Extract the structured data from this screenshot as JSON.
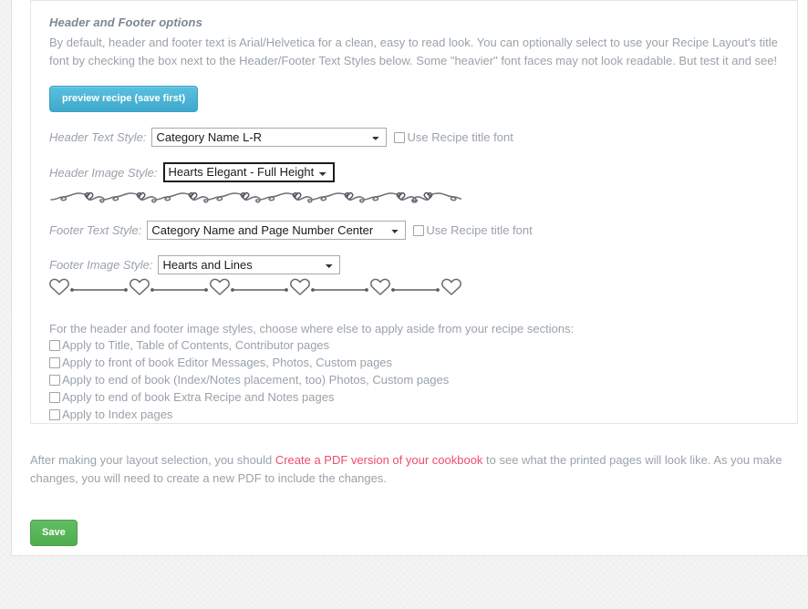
{
  "panel": {
    "title": "Header and Footer options",
    "description": "By default, header and footer text is Arial/Helvetica for a clean, easy to read look. You can optionally select to use your Recipe Layout's title font by checking the box next to the Header/Footer Text Styles below. Some \"heavier\" font faces may not look readable. But test it and see!",
    "preview_button": "preview recipe (save first)"
  },
  "fields": {
    "header_text": {
      "label": "Header Text Style:",
      "value": "Category Name L-R",
      "checkbox_label": "Use Recipe title font",
      "checked": false
    },
    "header_image": {
      "label": "Header Image Style:",
      "value": "Hearts Elegant - Full Height",
      "divider_name": "hearts-elegant-scrollwork-divider"
    },
    "footer_text": {
      "label": "Footer Text Style:",
      "value": "Category Name and Page Number Center",
      "checkbox_label": "Use Recipe title font",
      "checked": false
    },
    "footer_image": {
      "label": "Footer Image Style:",
      "value": "Hearts and Lines",
      "divider_name": "hearts-and-lines-divider"
    }
  },
  "apply_section": {
    "intro": "For the header and footer image styles, choose where else to apply aside from your recipe sections:",
    "options": [
      {
        "label": "Apply to Title, Table of Contents, Contributor pages",
        "checked": false
      },
      {
        "label": "Apply to front of book Editor Messages, Photos, Custom pages",
        "checked": false
      },
      {
        "label": "Apply to end of book (Index/Notes placement, too) Photos, Custom pages",
        "checked": false
      },
      {
        "label": "Apply to end of book Extra Recipe and Notes pages",
        "checked": false
      },
      {
        "label": "Apply to Index pages",
        "checked": false
      }
    ]
  },
  "footer": {
    "note_before": "After making your layout selection, you should ",
    "link_text": "Create a PDF version of your cookbook",
    "note_after": " to see what the printed pages will look like. As you make changes, you will need to create a new PDF to include the changes.",
    "save_button": "Save"
  },
  "colors": {
    "preview_button": "#46b8da",
    "save_button": "#5cb85c",
    "link": "#ef4a70",
    "body_text": "#9aa2ab",
    "panel_title": "#7c8794"
  }
}
